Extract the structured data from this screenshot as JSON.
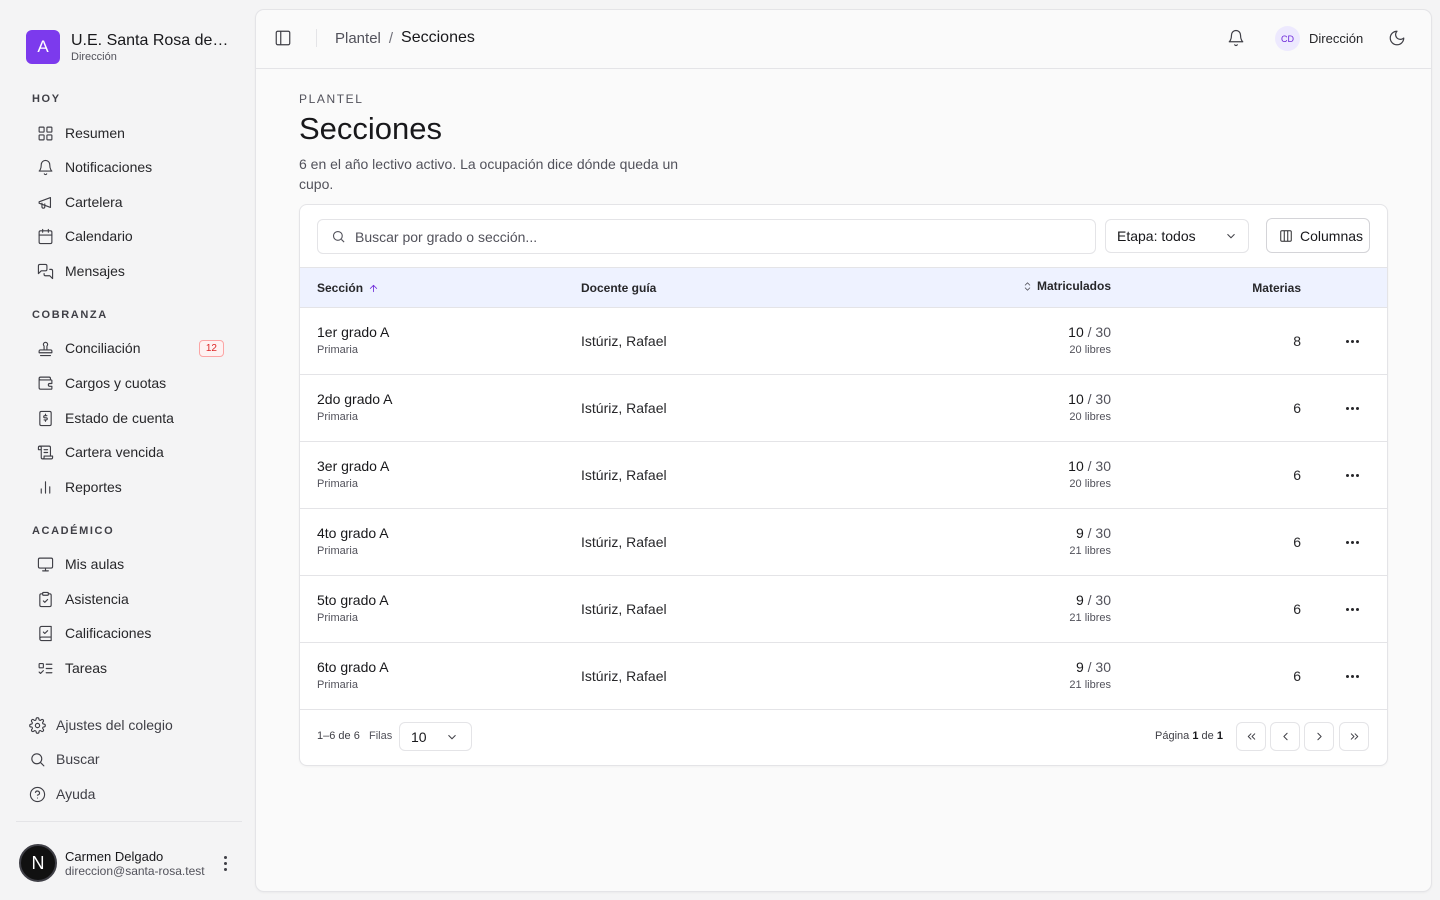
{
  "brand": {
    "logo_letter": "A",
    "name": "U.E. Santa Rosa de Lima",
    "role": "Dirección",
    "accent": "#7c3aed"
  },
  "sidebar": {
    "sections": [
      {
        "label": "HOY",
        "items": [
          {
            "label": "Resumen",
            "icon": "grid-icon"
          },
          {
            "label": "Notificaciones",
            "icon": "bell-icon"
          },
          {
            "label": "Cartelera",
            "icon": "megaphone-icon"
          },
          {
            "label": "Calendario",
            "icon": "calendar-icon"
          },
          {
            "label": "Mensajes",
            "icon": "messages-icon"
          }
        ]
      },
      {
        "label": "COBRANZA",
        "items": [
          {
            "label": "Conciliación",
            "icon": "stamp-icon",
            "badge": "12"
          },
          {
            "label": "Cargos y cuotas",
            "icon": "wallet-icon"
          },
          {
            "label": "Estado de cuenta",
            "icon": "receipt-icon"
          },
          {
            "label": "Cartera vencida",
            "icon": "scroll-icon"
          },
          {
            "label": "Reportes",
            "icon": "bar-chart-icon"
          }
        ]
      },
      {
        "label": "ACADÉMICO",
        "items": [
          {
            "label": "Mis aulas",
            "icon": "presentation-icon"
          },
          {
            "label": "Asistencia",
            "icon": "clipboard-check-icon"
          },
          {
            "label": "Calificaciones",
            "icon": "book-check-icon"
          },
          {
            "label": "Tareas",
            "icon": "list-todo-icon"
          }
        ]
      }
    ],
    "utilities": [
      {
        "label": "Ajustes del colegio",
        "icon": "settings-icon"
      },
      {
        "label": "Buscar",
        "icon": "search-icon"
      },
      {
        "label": "Ayuda",
        "icon": "help-circle-icon"
      }
    ],
    "user": {
      "initial": "N",
      "name": "Carmen Delgado",
      "email": "direccion@santa-rosa.test"
    }
  },
  "topbar": {
    "breadcrumb_parent": "Plantel",
    "breadcrumb_sep": "/",
    "breadcrumb_current": "Secciones",
    "account_initials": "CD",
    "account_name": "Dirección"
  },
  "page": {
    "eyebrow": "PLANTEL",
    "title": "Secciones",
    "description": "6 en el año lectivo activo. La ocupación dice dónde queda un cupo."
  },
  "toolbar": {
    "search_placeholder": "Buscar por grado o sección...",
    "stage_filter": "Etapa: todos",
    "columns_label": "Columnas"
  },
  "table": {
    "headers": {
      "section": "Sección",
      "teacher": "Docente guía",
      "enrolled": "Matriculados",
      "subjects": "Materias"
    },
    "rows": [
      {
        "section": "1er grado A",
        "stage": "Primaria",
        "teacher": "Istúriz, Rafael",
        "enrolled": "10",
        "capacity": "/ 30",
        "free": "20 libres",
        "subjects": "8"
      },
      {
        "section": "2do grado A",
        "stage": "Primaria",
        "teacher": "Istúriz, Rafael",
        "enrolled": "10",
        "capacity": "/ 30",
        "free": "20 libres",
        "subjects": "6"
      },
      {
        "section": "3er grado A",
        "stage": "Primaria",
        "teacher": "Istúriz, Rafael",
        "enrolled": "10",
        "capacity": "/ 30",
        "free": "20 libres",
        "subjects": "6"
      },
      {
        "section": "4to grado A",
        "stage": "Primaria",
        "teacher": "Istúriz, Rafael",
        "enrolled": "9",
        "capacity": "/ 30",
        "free": "21 libres",
        "subjects": "6"
      },
      {
        "section": "5to grado A",
        "stage": "Primaria",
        "teacher": "Istúriz, Rafael",
        "enrolled": "9",
        "capacity": "/ 30",
        "free": "21 libres",
        "subjects": "6"
      },
      {
        "section": "6to grado A",
        "stage": "Primaria",
        "teacher": "Istúriz, Rafael",
        "enrolled": "9",
        "capacity": "/ 30",
        "free": "21 libres",
        "subjects": "6"
      }
    ]
  },
  "footer": {
    "count": "1–6 de 6",
    "rows_label": "Filas",
    "rows_value": "10",
    "page_prefix": "Página",
    "page_current": "1",
    "page_of": "de",
    "page_total": "1"
  }
}
